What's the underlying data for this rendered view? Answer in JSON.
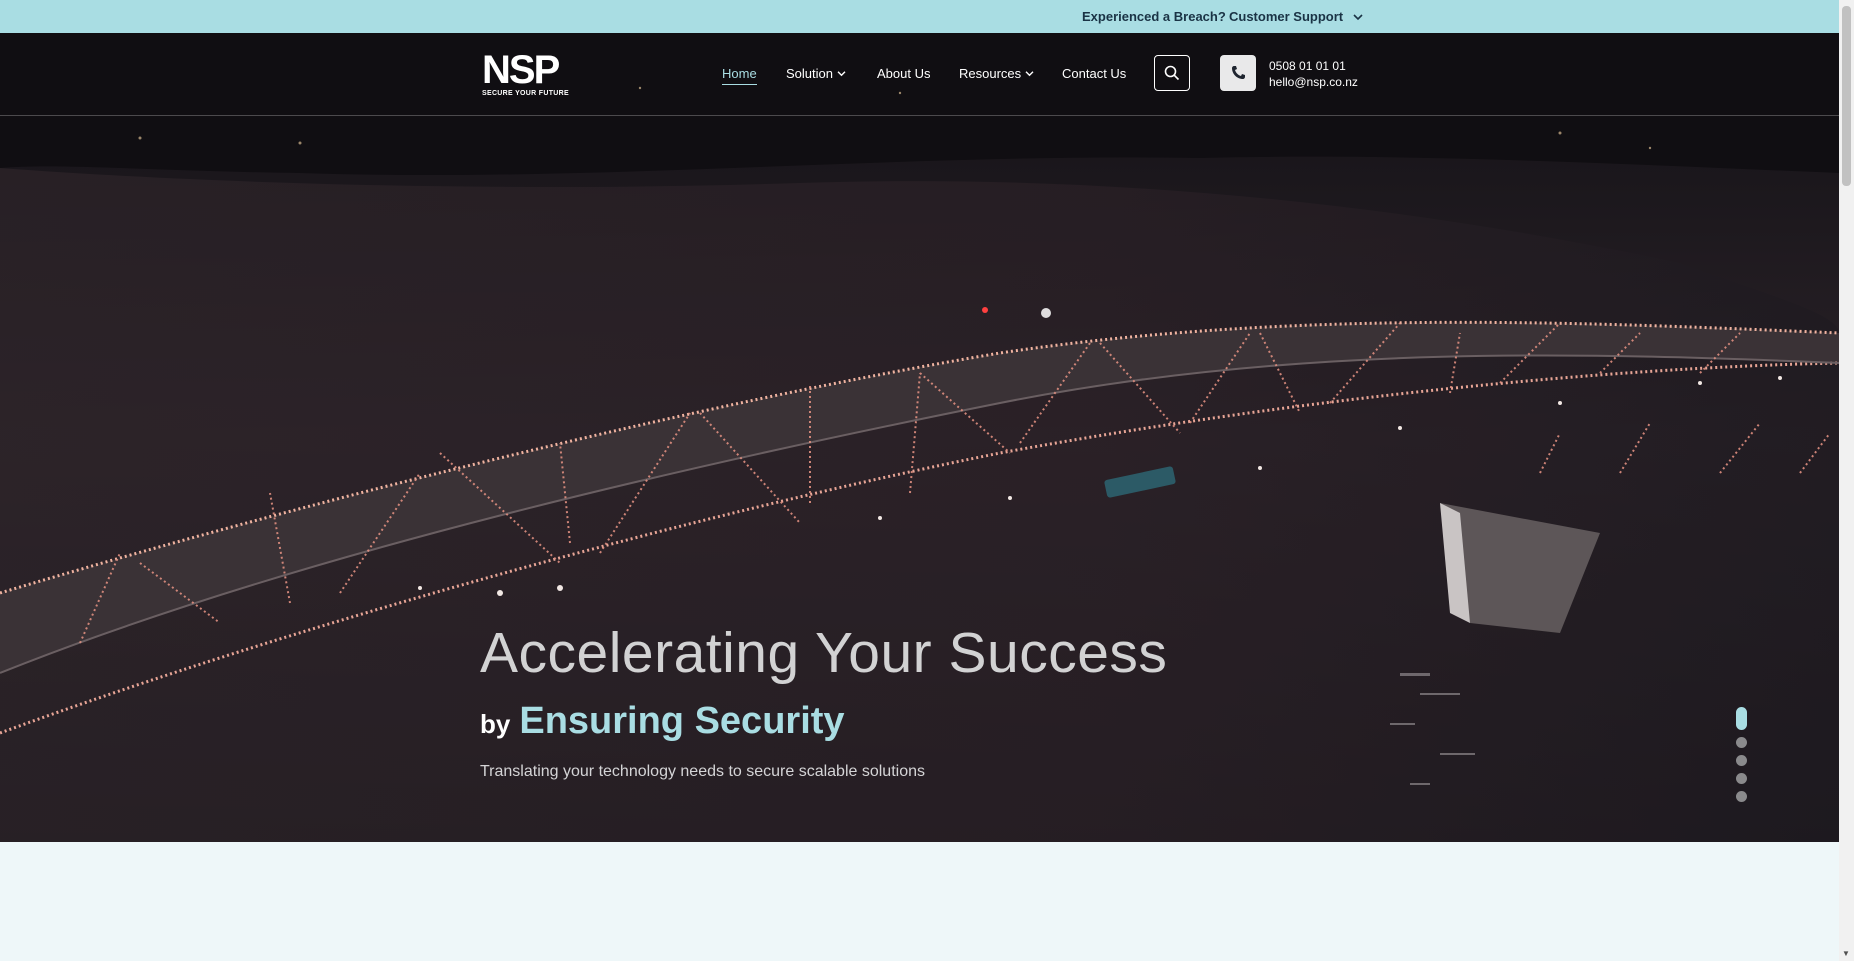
{
  "topbar": {
    "breach_link": "Experienced a Breach?",
    "support_label": "Customer Support"
  },
  "logo": {
    "wordmark": "NSP",
    "tagline": "SECURE YOUR FUTURE"
  },
  "nav": {
    "items": [
      {
        "label": "Home",
        "active": true
      },
      {
        "label": "Solution",
        "dropdown": true
      },
      {
        "label": "About Us"
      },
      {
        "label": "Resources",
        "dropdown": true
      },
      {
        "label": "Contact Us"
      }
    ]
  },
  "contact": {
    "phone": "0508 01 01 01",
    "email": "hello@nsp.co.nz"
  },
  "hero": {
    "title": "Accelerating Your Success",
    "by": "by",
    "accent": "Ensuring Security",
    "tagline": "Translating your technology needs to secure scalable solutions",
    "slides": 5,
    "active_slide": 1
  },
  "colors": {
    "accent": "#a9dde3",
    "topbar": "#a9dde3",
    "section_bg": "#eef7f9"
  },
  "icons": [
    "search-icon",
    "phone-icon",
    "chevron-down-icon"
  ]
}
